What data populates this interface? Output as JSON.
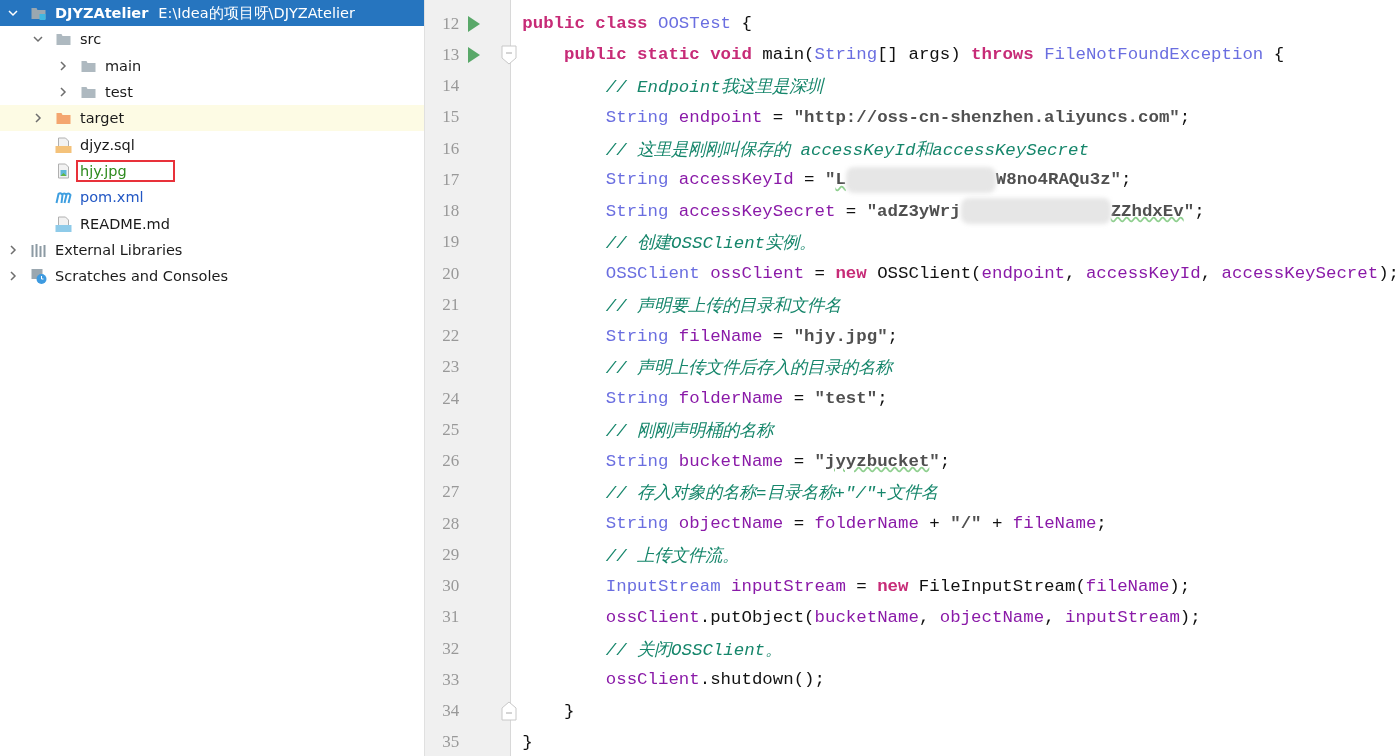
{
  "project_tree": {
    "items": [
      {
        "label": "DJYZAtelier",
        "path": "E:\\Idea的项目呀\\DJYZAtelier",
        "kind": "module",
        "selected": true,
        "expanded": true,
        "children": [
          {
            "label": "src",
            "kind": "folder",
            "selected": false,
            "expanded": true,
            "children": [
              {
                "label": "main",
                "kind": "folder",
                "selected": false,
                "expanded": false
              },
              {
                "label": "test",
                "kind": "folder",
                "selected": false,
                "expanded": false
              }
            ]
          },
          {
            "label": "target",
            "kind": "excluded",
            "selected": false,
            "expanded": false,
            "highlighted": true
          },
          {
            "label": "djyz.sql",
            "kind": "sql",
            "selected": false
          },
          {
            "label": "hjy.jpg",
            "kind": "image",
            "selected": false,
            "color": "#2e8b1e",
            "annotated": true
          },
          {
            "label": "pom.xml",
            "kind": "maven",
            "selected": false,
            "color": "#2257c4"
          },
          {
            "label": "README.md",
            "kind": "markdown",
            "selected": false
          }
        ]
      },
      {
        "label": "External Libraries",
        "kind": "libraries",
        "selected": false,
        "expanded": false
      },
      {
        "label": "Scratches and Consoles",
        "kind": "scratches",
        "selected": false,
        "expanded": false
      }
    ]
  },
  "editor": {
    "lines": [
      {
        "number": "12",
        "run": true,
        "tokens": [
          {
            "kind": "kw",
            "text": "public class"
          },
          {
            "kind": "type",
            "text": " OOSTest"
          },
          {
            "kind": "plain",
            "text": " {"
          }
        ]
      },
      {
        "number": "13",
        "run": true,
        "fold_start": true,
        "tokens": [
          {
            "kind": "kw",
            "text": "    public static void"
          },
          {
            "kind": "plain",
            "text": " main("
          },
          {
            "kind": "type",
            "text": "String"
          },
          {
            "kind": "plain",
            "text": "[] args)"
          },
          {
            "kind": "kw",
            "text": " throws"
          },
          {
            "kind": "type",
            "text": " FileNotFoundException"
          },
          {
            "kind": "plain",
            "text": " {"
          }
        ]
      },
      {
        "number": "14",
        "tokens": [
          {
            "kind": "comment",
            "text": "        // Endpoint我这里是深圳"
          }
        ]
      },
      {
        "number": "15",
        "tokens": [
          {
            "kind": "type",
            "text": "        String"
          },
          {
            "kind": "var",
            "text": " endpoint"
          },
          {
            "kind": "plain",
            "text": " = "
          },
          {
            "kind": "str",
            "text": "\"http://oss-cn-shenzhen.aliyuncs.com\""
          },
          {
            "kind": "plain",
            "text": ";"
          }
        ]
      },
      {
        "number": "16",
        "tokens": [
          {
            "kind": "comment",
            "text": "        // 这里是刚刚叫保存的 accessKeyId和accessKeySecret"
          }
        ]
      },
      {
        "number": "17",
        "tokens": [
          {
            "kind": "type",
            "text": "        String"
          },
          {
            "kind": "var",
            "text": " accessKeyId"
          },
          {
            "kind": "plain",
            "text": " = "
          },
          {
            "kind": "str",
            "text": "\""
          },
          {
            "kind": "typo",
            "text": "L"
          },
          {
            "kind": "blur"
          },
          {
            "kind": "str",
            "text": "W8no4RAQu3z\""
          },
          {
            "kind": "plain",
            "text": ";"
          }
        ]
      },
      {
        "number": "18",
        "tokens": [
          {
            "kind": "type",
            "text": "        String"
          },
          {
            "kind": "var",
            "text": " accessKeySecret"
          },
          {
            "kind": "plain",
            "text": " = "
          },
          {
            "kind": "str",
            "text": "\"adZ3yWrj"
          },
          {
            "kind": "blur"
          },
          {
            "kind": "typo",
            "text": "ZZhdxEv"
          },
          {
            "kind": "str",
            "text": "\""
          },
          {
            "kind": "plain",
            "text": ";"
          }
        ]
      },
      {
        "number": "19",
        "tokens": [
          {
            "kind": "comment",
            "text": "        // 创建OSSClient实例。"
          }
        ]
      },
      {
        "number": "20",
        "tokens": [
          {
            "kind": "type",
            "text": "        OSSClient"
          },
          {
            "kind": "var",
            "text": " ossClient"
          },
          {
            "kind": "plain",
            "text": " = "
          },
          {
            "kind": "kw",
            "text": "new"
          },
          {
            "kind": "plain",
            "text": " OSSClient("
          },
          {
            "kind": "var",
            "text": "endpoint"
          },
          {
            "kind": "plain",
            "text": ", "
          },
          {
            "kind": "var",
            "text": "accessKeyId"
          },
          {
            "kind": "plain",
            "text": ", "
          },
          {
            "kind": "var",
            "text": "accessKeySecret"
          },
          {
            "kind": "plain",
            "text": ");"
          }
        ]
      },
      {
        "number": "21",
        "tokens": [
          {
            "kind": "comment",
            "text": "        // 声明要上传的目录和文件名"
          }
        ]
      },
      {
        "number": "22",
        "tokens": [
          {
            "kind": "type",
            "text": "        String"
          },
          {
            "kind": "var",
            "text": " fileName"
          },
          {
            "kind": "plain",
            "text": " = "
          },
          {
            "kind": "str",
            "text": "\"hjy.jpg\""
          },
          {
            "kind": "plain",
            "text": ";"
          }
        ]
      },
      {
        "number": "23",
        "tokens": [
          {
            "kind": "comment",
            "text": "        // 声明上传文件后存入的目录的名称"
          }
        ]
      },
      {
        "number": "24",
        "tokens": [
          {
            "kind": "type",
            "text": "        String"
          },
          {
            "kind": "var",
            "text": " folderName"
          },
          {
            "kind": "plain",
            "text": " = "
          },
          {
            "kind": "str",
            "text": "\"test\""
          },
          {
            "kind": "plain",
            "text": ";"
          }
        ]
      },
      {
        "number": "25",
        "tokens": [
          {
            "kind": "comment",
            "text": "        // 刚刚声明桶的名称"
          }
        ]
      },
      {
        "number": "26",
        "tokens": [
          {
            "kind": "type",
            "text": "        String"
          },
          {
            "kind": "var",
            "text": " bucketName"
          },
          {
            "kind": "plain",
            "text": " = "
          },
          {
            "kind": "str",
            "text": "\""
          },
          {
            "kind": "typo",
            "text": "jyyzbucket"
          },
          {
            "kind": "str",
            "text": "\""
          },
          {
            "kind": "plain",
            "text": ";"
          }
        ]
      },
      {
        "number": "27",
        "tokens": [
          {
            "kind": "comment",
            "text": "        // 存入对象的名称=目录名称+\"/\"+文件名"
          }
        ]
      },
      {
        "number": "28",
        "tokens": [
          {
            "kind": "type",
            "text": "        String"
          },
          {
            "kind": "var",
            "text": " objectName"
          },
          {
            "kind": "plain",
            "text": " = "
          },
          {
            "kind": "var",
            "text": "folderName"
          },
          {
            "kind": "plain",
            "text": " + "
          },
          {
            "kind": "str",
            "text": "\"/\""
          },
          {
            "kind": "plain",
            "text": " + "
          },
          {
            "kind": "var",
            "text": "fileName"
          },
          {
            "kind": "plain",
            "text": ";"
          }
        ]
      },
      {
        "number": "29",
        "tokens": [
          {
            "kind": "comment",
            "text": "        // 上传文件流。"
          }
        ]
      },
      {
        "number": "30",
        "tokens": [
          {
            "kind": "type",
            "text": "        InputStream"
          },
          {
            "kind": "var",
            "text": " inputStream"
          },
          {
            "kind": "plain",
            "text": " = "
          },
          {
            "kind": "kw",
            "text": "new"
          },
          {
            "kind": "plain",
            "text": " FileInputStream("
          },
          {
            "kind": "var",
            "text": "fileName"
          },
          {
            "kind": "plain",
            "text": ");"
          }
        ]
      },
      {
        "number": "31",
        "tokens": [
          {
            "kind": "var",
            "text": "        ossClient"
          },
          {
            "kind": "plain",
            "text": ".putObject("
          },
          {
            "kind": "var",
            "text": "bucketName"
          },
          {
            "kind": "plain",
            "text": ", "
          },
          {
            "kind": "var",
            "text": "objectName"
          },
          {
            "kind": "plain",
            "text": ", "
          },
          {
            "kind": "var",
            "text": "inputStream"
          },
          {
            "kind": "plain",
            "text": ");"
          }
        ]
      },
      {
        "number": "32",
        "tokens": [
          {
            "kind": "comment",
            "text": "        // 关闭OSSClient。"
          }
        ]
      },
      {
        "number": "33",
        "tokens": [
          {
            "kind": "var",
            "text": "        ossClient"
          },
          {
            "kind": "plain",
            "text": ".shutdown();"
          }
        ]
      },
      {
        "number": "34",
        "fold_end": true,
        "tokens": [
          {
            "kind": "plain",
            "text": "    }"
          }
        ]
      },
      {
        "number": "35",
        "tokens": [
          {
            "kind": "plain",
            "text": "}"
          }
        ]
      }
    ]
  }
}
